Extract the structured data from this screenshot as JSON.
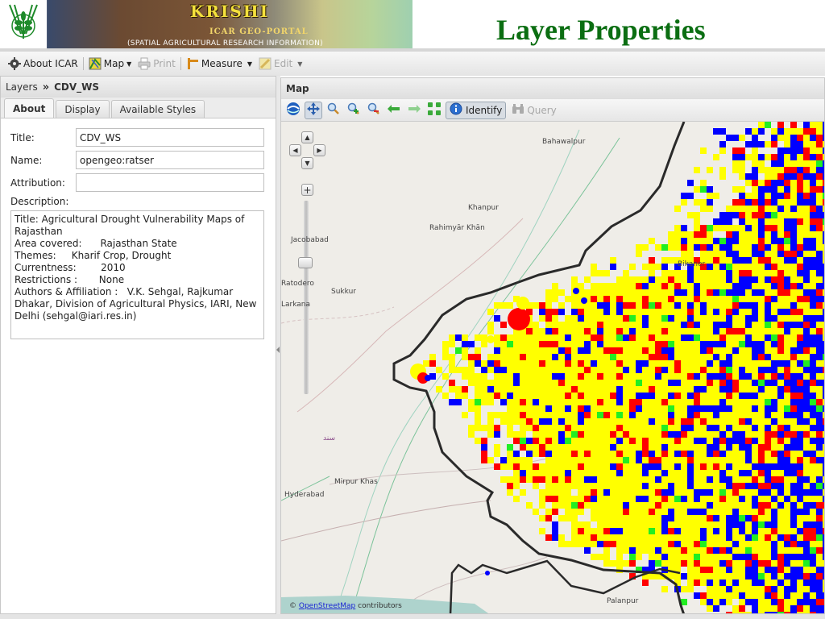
{
  "banner": {
    "title": "KRISHI",
    "subtitle": "ICAR GEO-PORTAL",
    "tagline": "(SPATIAL AGRICULTURAL RESEARCH INFORMATION)"
  },
  "slide_title": "Layer Properties",
  "toolbar": {
    "items": [
      {
        "label": "About ICAR",
        "icon": "gear-icon",
        "enabled": true
      },
      {
        "label": "Map",
        "icon": "map-icon",
        "enabled": true,
        "dropdown": true
      },
      {
        "label": "Print",
        "icon": "print-icon",
        "enabled": false
      },
      {
        "label": "Measure",
        "icon": "ruler-icon",
        "enabled": true,
        "dropdown": true
      },
      {
        "label": "Edit",
        "icon": "edit-icon",
        "enabled": false,
        "dropdown": true
      }
    ]
  },
  "left_panel": {
    "breadcrumb_root": "Layers",
    "breadcrumb_sep": "»",
    "layer_name": "CDV_WS",
    "tabs": [
      {
        "label": "About",
        "active": true
      },
      {
        "label": "Display",
        "active": false
      },
      {
        "label": "Available Styles",
        "active": false
      }
    ],
    "form": {
      "title_label": "Title:",
      "title_value": "CDV_WS",
      "name_label": "Name:",
      "name_value": "opengeo:ratser",
      "attribution_label": "Attribution:",
      "attribution_value": "",
      "description_label": "Description:",
      "description_value": "Title: Agricultural Drought Vulnerability Maps of\nRajasthan\nArea covered:      Rajasthan State\nThemes:     Kharif Crop, Drought\nCurrentness:        2010\nRestrictions :       None\nAuthors & Affiliation :   V.K. Sehgal, Rajkumar\nDhakar, Division of Agricultural Physics, IARI, New\nDelhi (sehgal@iari.res.in)"
    }
  },
  "map_panel": {
    "title": "Map",
    "tools": {
      "identify_label": "Identify",
      "query_label": "Query"
    },
    "places": [
      {
        "name": "Bahawalpur"
      },
      {
        "name": "Khanpur"
      },
      {
        "name": "Rahimyār Khān"
      },
      {
        "name": "Jacobabad"
      },
      {
        "name": "Ratodero"
      },
      {
        "name": "Sukkur"
      },
      {
        "name": "Larkana"
      },
      {
        "name": "Bikaner"
      },
      {
        "name": "Mirpur Khas"
      },
      {
        "name": "Hyderabad"
      },
      {
        "name": "Palanpur"
      },
      {
        "name": "سند"
      }
    ],
    "attribution_prefix": "©",
    "attribution_link": "OpenStreetMap",
    "attribution_suffix": "contributors",
    "legend_colors": {
      "yellow": "#ffff00",
      "red": "#ff0000",
      "blue": "#0000ff",
      "green": "#22ee22",
      "border": "#2a2a2a"
    }
  }
}
